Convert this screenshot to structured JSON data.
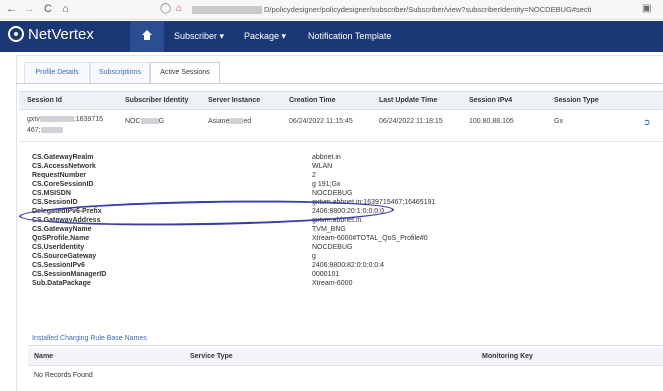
{
  "browser": {
    "back_icon": "←",
    "forward_icon": "→",
    "reload_icon": "C",
    "home_icon": "⌂",
    "url": "D/policydesigner/policydesigner/subscriber/Subscriber/view?subscriberIdentity=NOCDEBUG#secti"
  },
  "app": {
    "brand": "NetVertex",
    "brand_color": "#1c3775",
    "menu": {
      "subscriber": "Subscriber ▾",
      "package": "Package ▾",
      "notification": "Notification Template"
    }
  },
  "tabs": [
    "Profile Details",
    "Subscriptions",
    "Active Sessions"
  ],
  "sessions": {
    "headers": [
      "Session Id",
      "Subscriber Identity",
      "Server Instance",
      "Creation Time",
      "Last Update Time",
      "Session IPv4",
      "Session Type"
    ],
    "row": {
      "session_id_a": "gxtv",
      "session_id_b": ";1639715",
      "session_id_c": "467;",
      "identity_a": "NOC",
      "identity_b": "G",
      "instance_a": "Asiane",
      "instance_b": "ed",
      "creation": "06/24/2022 11:15:45",
      "update": "06/24/2022 11:18:15",
      "ipv4": "100.80.88.105",
      "type": "Gx"
    }
  },
  "details": [
    {
      "key": "CS.GatewayRealm",
      "value": "abbnet.in"
    },
    {
      "key": "CS.AccessNetwork",
      "value": "WLAN"
    },
    {
      "key": "RequestNumber",
      "value": "2"
    },
    {
      "key": "CS.CoreSessionID",
      "value": "g                                         191;Gx"
    },
    {
      "key": "CS.MSISDN",
      "value": "NOCDEBUG"
    },
    {
      "key": "CS.SessionID",
      "value": "gxtvm.abbnet.in;1639715467;16465191"
    },
    {
      "key": "DelegatedIPv6-Prefix",
      "value": "2406:8800:20:1:0:0:0:0"
    },
    {
      "key": "CS.GatewayAddress",
      "value": "gxtvm.abbnet.in"
    },
    {
      "key": "CS.GatewayName",
      "value": "TVM_BNG"
    },
    {
      "key": "QoSProfile.Name",
      "value": "Xtream-6000#TOTAL_QoS_Profile#0"
    },
    {
      "key": "CS.UserIdentity",
      "value": "NOCDEBUG"
    },
    {
      "key": "CS.SourceGateway",
      "value": "g"
    },
    {
      "key": "CS.SessionIPv6",
      "value": "2406:8800:82:0:0:0:0:4"
    },
    {
      "key": "CS.SessionManagerID",
      "value": "0000101"
    },
    {
      "key": "Sub.DataPackage",
      "value": "Xtream-6000"
    }
  ],
  "charging_rules": {
    "title": "Installed Charging Rule Base Names",
    "headers": [
      "Name",
      "Service Type",
      "Monitoring Key"
    ],
    "empty": "No Records Found"
  }
}
